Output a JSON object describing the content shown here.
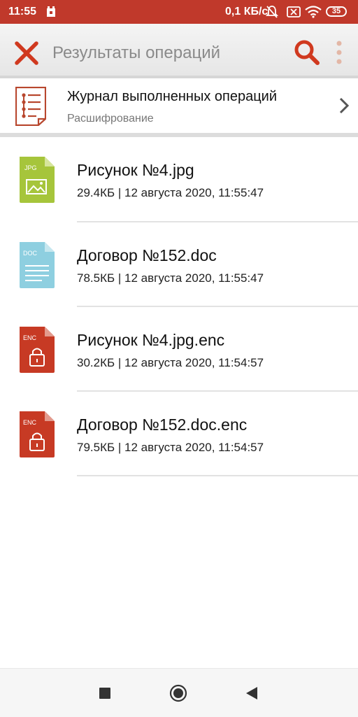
{
  "status_bar": {
    "time": "11:55",
    "network_speed": "0,1 КБ/с",
    "battery": "35"
  },
  "toolbar": {
    "title": "Результаты операций",
    "close_icon": "close-icon",
    "search_icon": "search-icon",
    "more_icon": "more-vert-icon"
  },
  "journal": {
    "title": "Журнал выполненных операций",
    "subtitle": "Расшифрование",
    "icon": "journal-list-icon"
  },
  "files": [
    {
      "name": "Рисунок №4.jpg",
      "meta": "29.4КБ | 12 августа 2020, 11:55:47",
      "type_label": "JPG",
      "icon": "jpg-file-icon",
      "color": "#a6c53b"
    },
    {
      "name": "Договор №152.doc",
      "meta": "78.5КБ | 12 августа 2020, 11:55:47",
      "type_label": "DOC",
      "icon": "doc-file-icon",
      "color": "#8ecfe0"
    },
    {
      "name": "Рисунок №4.jpg.enc",
      "meta": "30.2КБ | 12 августа 2020, 11:54:57",
      "type_label": "ENC",
      "icon": "enc-file-icon",
      "color": "#c73a24"
    },
    {
      "name": "Договор №152.doc.enc",
      "meta": "79.5КБ | 12 августа 2020, 11:54:57",
      "type_label": "ENC",
      "icon": "enc-file-icon",
      "color": "#c73a24"
    }
  ],
  "colors": {
    "accent": "#c0392b",
    "status_bar": "#c0392b"
  }
}
